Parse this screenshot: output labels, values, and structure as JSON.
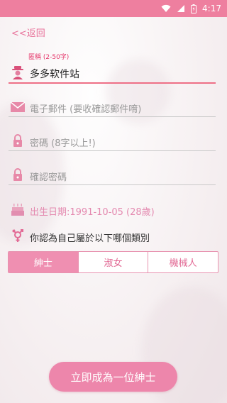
{
  "status_bar": {
    "time": "4:17",
    "icons": [
      "wifi-icon",
      "signal-icon",
      "battery-icon"
    ]
  },
  "nav": {
    "back_label": "<<返回"
  },
  "form": {
    "nickname": {
      "float_label": "匿稱 (2-50字)",
      "value": "多多软件站",
      "icon": "user-icon"
    },
    "email": {
      "placeholder": "電子郵件 (要收確認郵件唷)",
      "icon": "envelope-icon"
    },
    "password": {
      "placeholder": "密碼 (8字以上!)",
      "icon": "lock-icon"
    },
    "confirm_password": {
      "placeholder": "確認密碼",
      "icon": "lock-icon"
    },
    "birthday": {
      "text": "出生日期:1991-10-05 (28歲)",
      "icon": "cake-icon"
    },
    "gender_question": {
      "text": "你認為自己屬於以下哪個類別",
      "icon": "gender-icon"
    },
    "gender_options": [
      "紳士",
      "淑女",
      "機械人"
    ],
    "gender_selected": "紳士"
  },
  "submit": {
    "label": "立即成為一位紳士"
  },
  "colors": {
    "accent": "#ee7f9f",
    "accent_light": "#ef8fb1",
    "underline_active": "#ee6f86",
    "birthday_text": "#e48ab0"
  }
}
